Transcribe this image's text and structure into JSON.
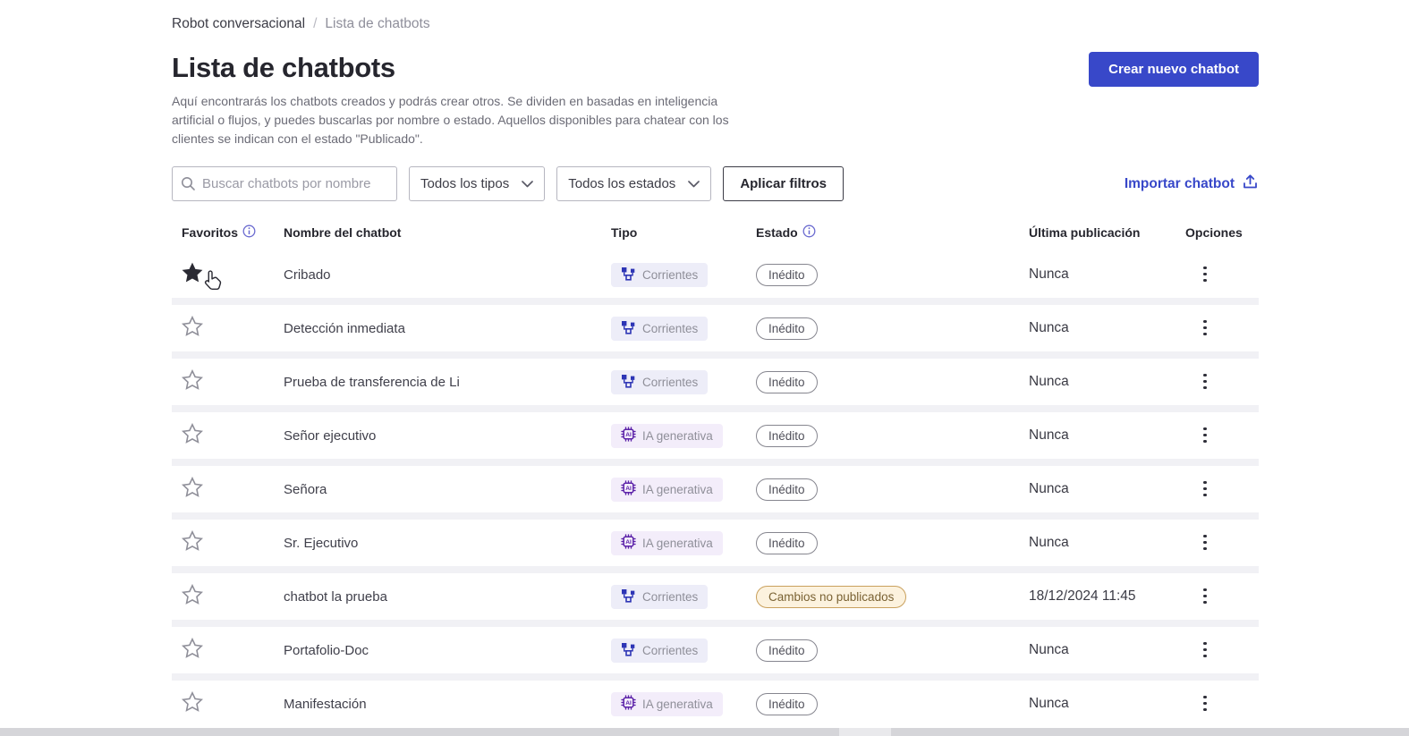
{
  "breadcrumb": {
    "root": "Robot conversacional",
    "separator": "/",
    "current": "Lista de chatbots"
  },
  "header": {
    "title": "Lista de chatbots",
    "description": "Aquí encontrarás los chatbots creados y podrás crear otros. Se dividen en basadas en inteligencia artificial o flujos, y puedes buscarlas por nombre o estado. Aquellos disponibles para chatear con los clientes se indican con el estado \"Publicado\".",
    "create_button": "Crear nuevo chatbot"
  },
  "filters": {
    "search_placeholder": "Buscar chatbots por nombre",
    "type_select": "Todos los tipos",
    "state_select": "Todos los estados",
    "apply_button": "Aplicar filtros",
    "import_link": "Importar chatbot"
  },
  "table": {
    "columns": {
      "favorites": "Favoritos",
      "name": "Nombre del chatbot",
      "type": "Tipo",
      "status": "Estado",
      "last_published": "Última publicación",
      "options": "Opciones"
    },
    "rows": [
      {
        "favorite": true,
        "name": "Cribado",
        "type": "Corrientes",
        "type_kind": "flow",
        "status": "Inédito",
        "status_kind": "plain",
        "last_published": "Nunca"
      },
      {
        "favorite": false,
        "name": "Detección inmediata",
        "type": "Corrientes",
        "type_kind": "flow",
        "status": "Inédito",
        "status_kind": "plain",
        "last_published": "Nunca"
      },
      {
        "favorite": false,
        "name": "Prueba de transferencia de Li",
        "type": "Corrientes",
        "type_kind": "flow",
        "status": "Inédito",
        "status_kind": "plain",
        "last_published": "Nunca"
      },
      {
        "favorite": false,
        "name": "Señor ejecutivo",
        "type": "IA generativa",
        "type_kind": "ai",
        "status": "Inédito",
        "status_kind": "plain",
        "last_published": "Nunca"
      },
      {
        "favorite": false,
        "name": "Señora",
        "type": "IA generativa",
        "type_kind": "ai",
        "status": "Inédito",
        "status_kind": "plain",
        "last_published": "Nunca"
      },
      {
        "favorite": false,
        "name": "Sr. Ejecutivo",
        "type": "IA generativa",
        "type_kind": "ai",
        "status": "Inédito",
        "status_kind": "plain",
        "last_published": "Nunca"
      },
      {
        "favorite": false,
        "name": "chatbot la prueba",
        "type": "Corrientes",
        "type_kind": "flow",
        "status": "Cambios no publicados",
        "status_kind": "warn",
        "last_published": "18/12/2024 11:45"
      },
      {
        "favorite": false,
        "name": "Portafolio-Doc",
        "type": "Corrientes",
        "type_kind": "flow",
        "status": "Inédito",
        "status_kind": "plain",
        "last_published": "Nunca"
      },
      {
        "favorite": false,
        "name": "Manifestación",
        "type": "IA generativa",
        "type_kind": "ai",
        "status": "Inédito",
        "status_kind": "plain",
        "last_published": "Nunca"
      }
    ]
  },
  "colors": {
    "primary": "#3848c9",
    "badge_bg": "#ededf8",
    "badge_ai_bg": "#f3edfa",
    "flow_icon": "#2d35b5",
    "ai_icon": "#5b21a8",
    "warn_bg": "#fcf2de",
    "warn_border": "#c9a05c",
    "warn_text": "#7a6233"
  }
}
